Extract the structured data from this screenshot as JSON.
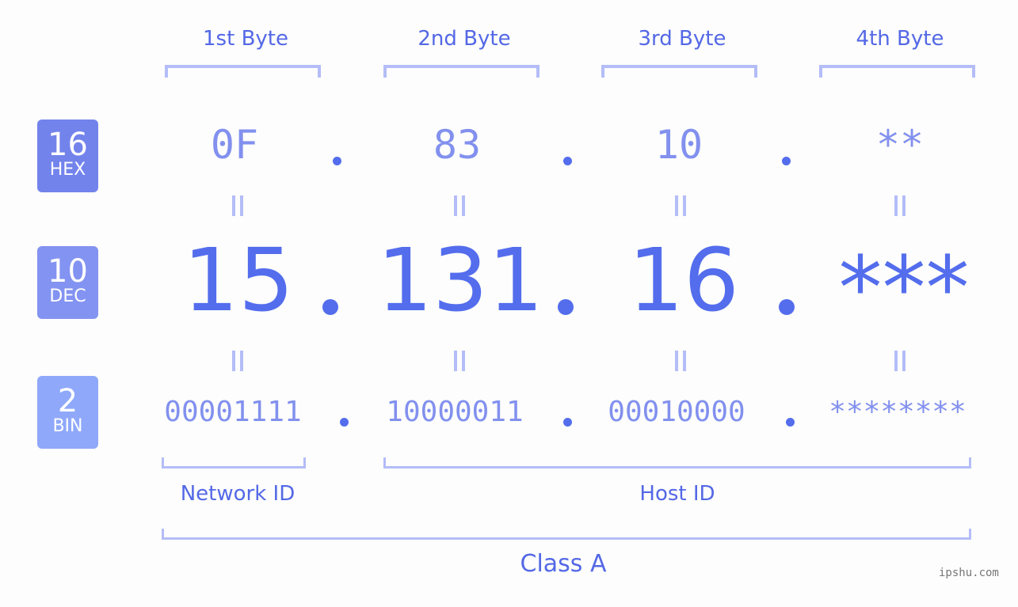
{
  "header": {
    "bytes": [
      "1st Byte",
      "2nd Byte",
      "3rd Byte",
      "4th Byte"
    ]
  },
  "badges": {
    "hex": {
      "number": "16",
      "label": "HEX",
      "color": "#7383ec"
    },
    "dec": {
      "number": "10",
      "label": "DEC",
      "color": "#8393f1"
    },
    "bin": {
      "number": "2",
      "label": "BIN",
      "color": "#8fa8fa"
    }
  },
  "ip": {
    "hex": [
      "0F",
      "83",
      "10",
      "**"
    ],
    "dec": [
      "15",
      "131",
      "16",
      "***"
    ],
    "bin": [
      "00001111",
      "10000011",
      "00010000",
      "********"
    ]
  },
  "labels": {
    "network_id": "Network ID",
    "host_id": "Host ID",
    "class": "Class A"
  },
  "colors": {
    "accent": "#546ded",
    "muted_value": "#8290ee",
    "bracket": "#b4bdf8"
  },
  "watermark": "ipshu.com"
}
